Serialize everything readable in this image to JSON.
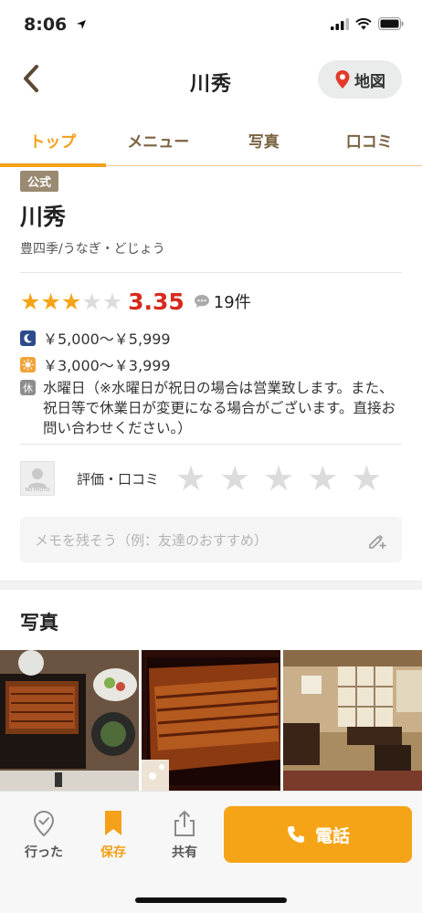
{
  "status": {
    "time": "8:06"
  },
  "nav": {
    "title": "川秀",
    "map_label": "地図"
  },
  "tabs": [
    {
      "label": "トップ",
      "active": true
    },
    {
      "label": "メニュー",
      "active": false
    },
    {
      "label": "写真",
      "active": false
    },
    {
      "label": "口コミ",
      "active": false
    }
  ],
  "shop": {
    "badge": "公式",
    "name": "川秀",
    "genre": "豊四季/うなぎ・どじょう",
    "rating": {
      "score": "3.35",
      "stars_filled": 3,
      "stars_total": 5,
      "reviews": "19件"
    },
    "price_dinner": "￥5,000〜￥5,999",
    "price_lunch": "￥3,000〜￥3,999",
    "holiday_icon": "休",
    "holiday": "水曜日（※水曜日が祝日の場合は営業致します。また、祝日等で休業日が変更になる場合がございます。直接お問い合わせください。）"
  },
  "evaluation": {
    "noimg_label": "NO PHOTO",
    "label": "評価・口コミ"
  },
  "memo": {
    "placeholder": "メモを残そう（例：友達のおすすめ）"
  },
  "photos": {
    "title": "写真"
  },
  "bottom": {
    "visited": "行った",
    "saved": "保存",
    "share": "共有",
    "call": "電話"
  },
  "colors": {
    "accent": "#f6a417",
    "score": "#d72a1c",
    "tab_text": "#7a6340"
  }
}
